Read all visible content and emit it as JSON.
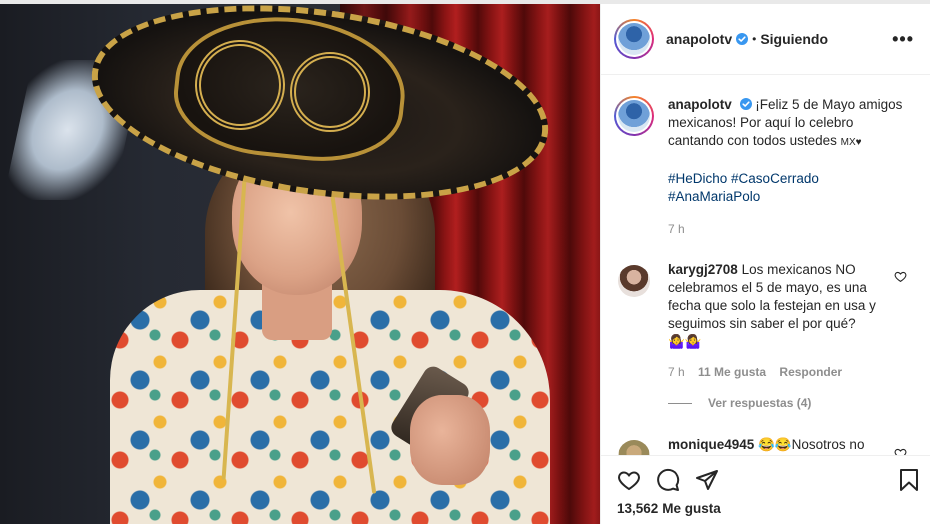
{
  "post": {
    "username": "anapolotv",
    "follow_state": "Siguiendo",
    "more_glyph": "•••",
    "caption_user": "anapolotv",
    "caption_text": "¡Feliz 5 de Mayo amigos mexicanos! Por aquí lo celebro cantando con todos ustedes",
    "caption_emoji": "MX♥",
    "hashtags": [
      "#HeDicho",
      "#CasoCerrado",
      "#AnaMariaPolo"
    ],
    "caption_time": "7 h",
    "likes_count": "13,562",
    "likes_label": "Me gusta"
  },
  "comments": [
    {
      "username": "karygj2708",
      "text": "Los mexicanos NO celebramos el 5 de mayo, es una fecha que solo la festejan en usa y seguimos sin saber el por qué?",
      "emoji": "🤷‍♀️🤷‍♀️",
      "time": "7 h",
      "likes": "11 Me gusta",
      "reply": "Responder",
      "view_replies": "Ver respuestas (4)"
    },
    {
      "username": "monique4945",
      "text": "😂😂Nosotros no"
    }
  ],
  "icons": {
    "verified": "verified-badge-icon",
    "like": "heart-icon",
    "comment": "comment-icon",
    "share": "paper-plane-icon",
    "save": "bookmark-icon"
  },
  "colors": {
    "verified_blue": "#3897f0",
    "hashtag": "#00376b",
    "muted": "#8e8e8e",
    "text": "#262626"
  }
}
